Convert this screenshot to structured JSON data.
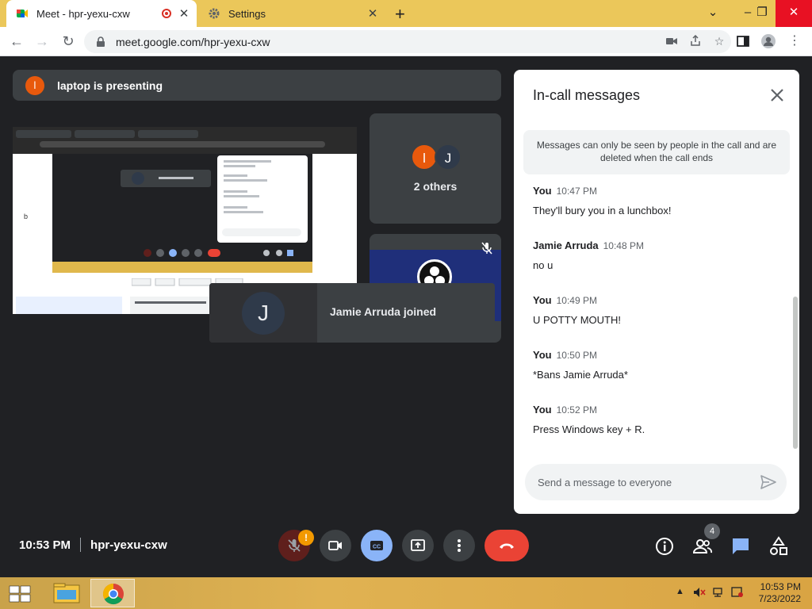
{
  "browser": {
    "tabs": [
      {
        "title": "Meet - hpr-yexu-cxw"
      },
      {
        "title": "Settings"
      }
    ],
    "url": "meet.google.com/hpr-yexu-cxw"
  },
  "meet": {
    "presenting_text": "laptop is presenting",
    "presenter_initial": "l",
    "shared_screen_text": "b",
    "others": {
      "initials": [
        "l",
        "J"
      ],
      "label": "2 others"
    },
    "toast": {
      "initial": "J",
      "text": "Jamie Arruda joined"
    },
    "meeting_time": "10:53 PM",
    "meeting_code": "hpr-yexu-cxw",
    "mic_warning": "!",
    "people_count": "4"
  },
  "chat": {
    "title": "In-call messages",
    "notice": "Messages can only be seen by people in the call and are deleted when the call ends",
    "messages": [
      {
        "sender": "You",
        "time": "10:47 PM",
        "text": "They'll bury you in a lunchbox!"
      },
      {
        "sender": "Jamie Arruda",
        "time": "10:48 PM",
        "text": "no u"
      },
      {
        "sender": "You",
        "time": "10:49 PM",
        "text": "U POTTY MOUTH!"
      },
      {
        "sender": "You",
        "time": "10:50 PM",
        "text": "*Bans Jamie Arruda*"
      },
      {
        "sender": "You",
        "time": "10:52 PM",
        "text": "Press Windows key + R."
      }
    ],
    "input_placeholder": "Send a message to everyone"
  },
  "taskbar": {
    "clock_time": "10:53 PM",
    "clock_date": "7/23/2022"
  },
  "colors": {
    "meet_bg": "#202124",
    "tile": "#3c4043",
    "end_call": "#ea4335",
    "captions_active": "#8ab4f8",
    "chat_active": "#8ab4f8",
    "tabstrip": "#ebc75a"
  },
  "icons": [
    "meet-favicon",
    "recording-icon",
    "gear-icon",
    "lock-icon",
    "camera-icon",
    "share-icon",
    "star-icon",
    "sidebar-icon",
    "profile-icon",
    "kebab-icon",
    "mic-off-icon",
    "camera-toggle-icon",
    "captions-icon",
    "present-icon",
    "more-icon",
    "end-call-icon",
    "info-icon",
    "people-icon",
    "chat-icon",
    "activities-icon",
    "send-icon",
    "close-icon",
    "windows-start-icon",
    "file-explorer-icon",
    "chrome-icon"
  ]
}
